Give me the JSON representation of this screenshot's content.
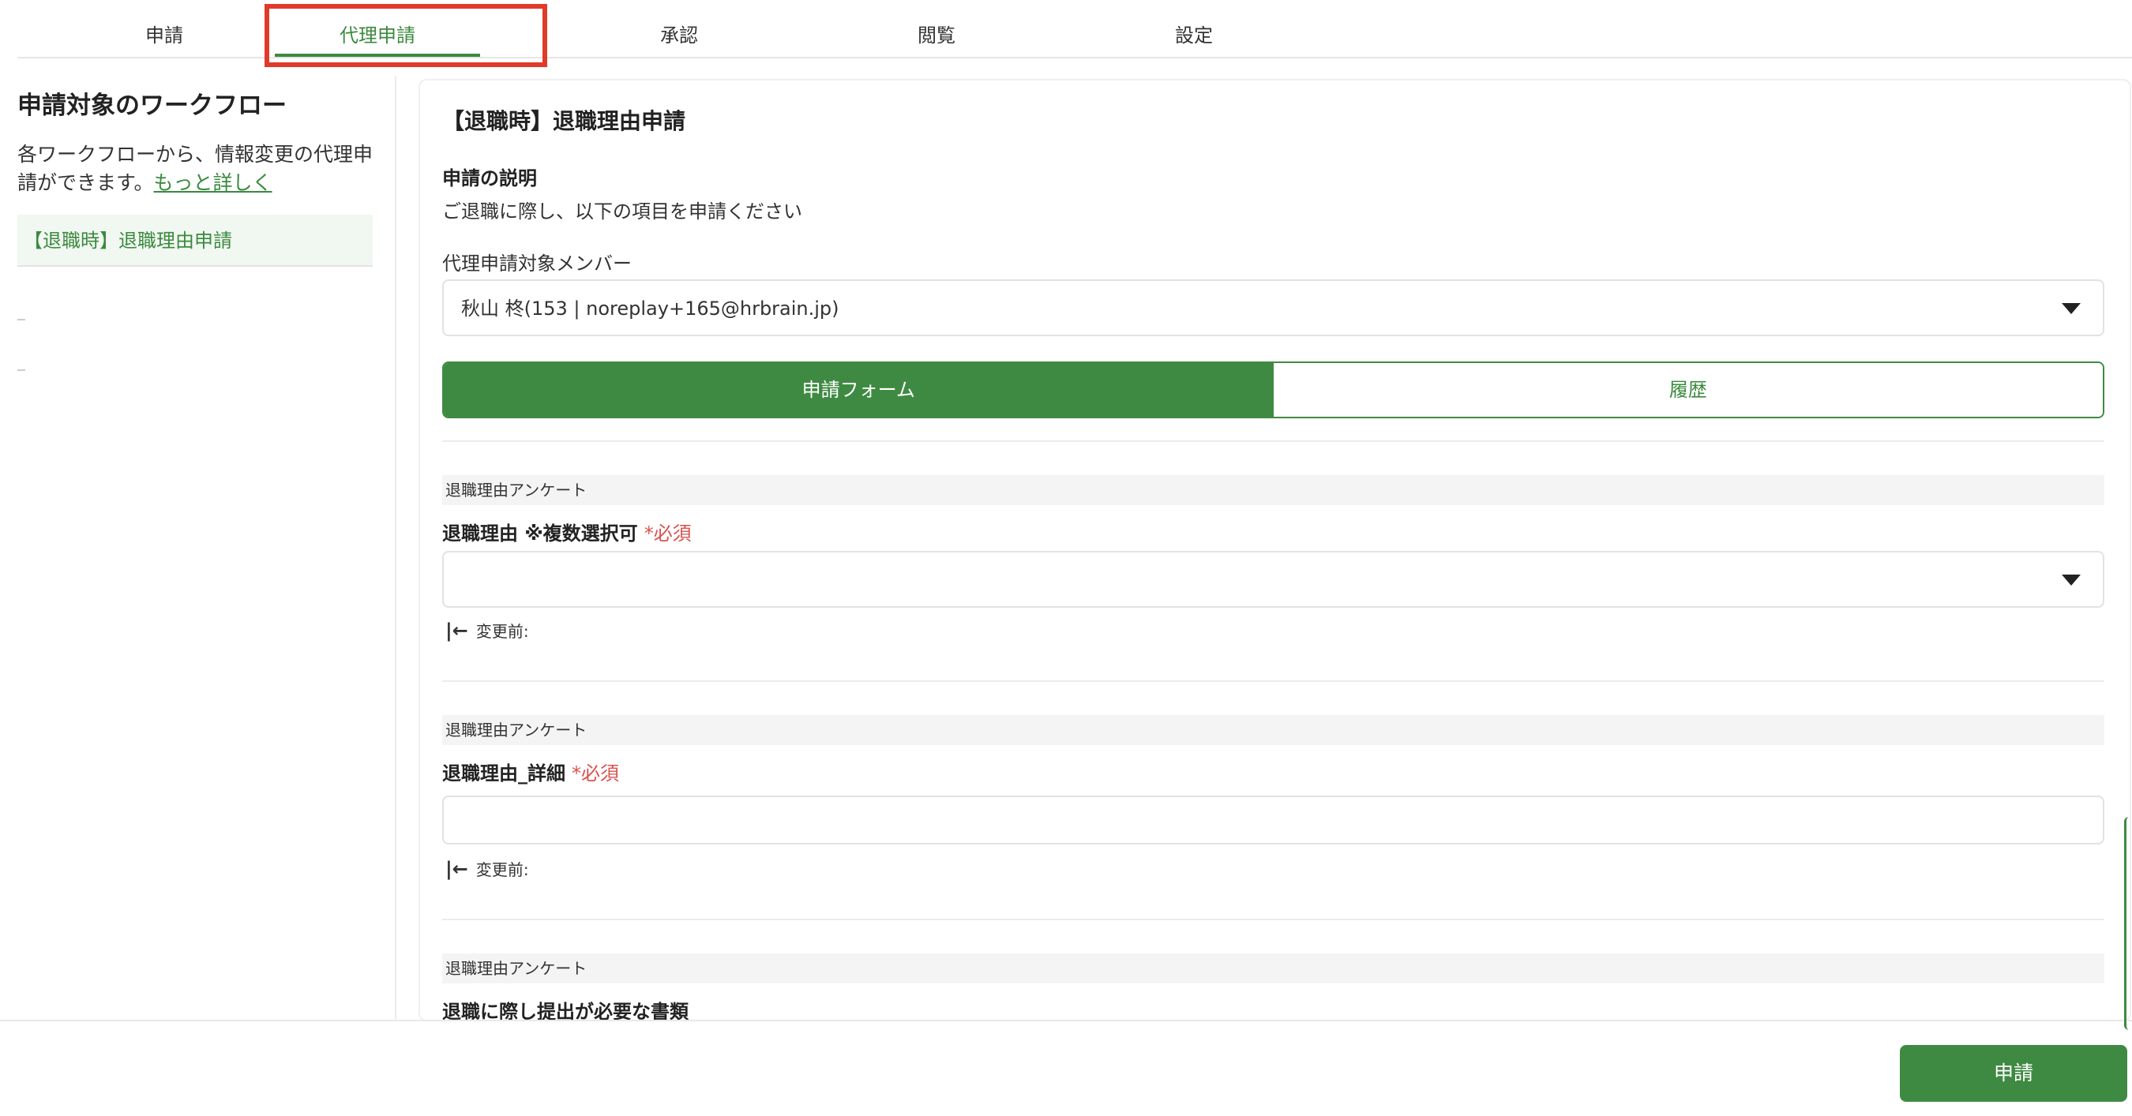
{
  "tabs": [
    {
      "label": "申請"
    },
    {
      "label": "代理申請"
    },
    {
      "label": "承認"
    },
    {
      "label": "閲覧"
    },
    {
      "label": "設定"
    }
  ],
  "sidebar": {
    "title": "申請対象のワークフロー",
    "description": "各ワークフローから、情報変更の代理申請ができます。",
    "more_link": "もっと詳しく",
    "items": [
      {
        "label": "【退職時】退職理由申請"
      }
    ]
  },
  "main": {
    "workflow_title": "【退職時】退職理由申請",
    "description_label": "申請の説明",
    "description_text": "ご退職に際し、以下の項目を申請ください",
    "member_label": "代理申請対象メンバー",
    "member_value": "秋山 柊(153 | noreplay+165@hrbrain.jp)",
    "segments": [
      {
        "label": "申請フォーム"
      },
      {
        "label": "履歴"
      }
    ],
    "sections": [
      {
        "category": "退職理由アンケート",
        "label": "退職理由 ※複数選択可",
        "required": "*必須",
        "before": "変更前:"
      },
      {
        "category": "退職理由アンケート",
        "label": "退職理由_詳細",
        "required": "*必須",
        "before": "変更前:"
      },
      {
        "category": "退職理由アンケート",
        "label": "退職に際し提出が必要な書類"
      }
    ]
  },
  "footer": {
    "submit_label": "申請"
  },
  "colors": {
    "accent": "#3f8a42",
    "required": "#d9534f",
    "highlight": "#e03a2a"
  },
  "icons": {
    "dropdown": "caret-down-icon",
    "before": "arrow-left-bar-icon"
  }
}
